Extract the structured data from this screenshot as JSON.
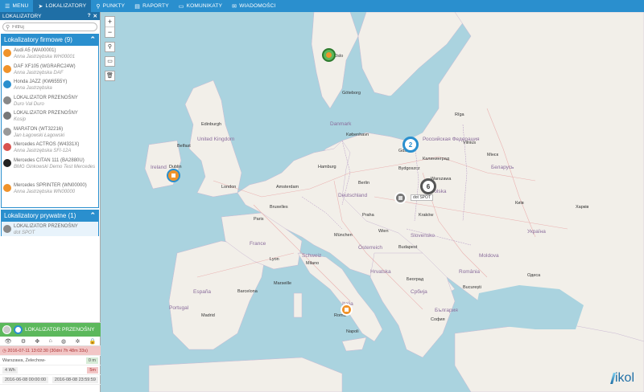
{
  "topbar": {
    "tabs": [
      {
        "label": "MENU",
        "icon": "menu-icon"
      },
      {
        "label": "LOKALIZATORY",
        "icon": "location-arrow-icon"
      },
      {
        "label": "PUNKTY",
        "icon": "pin-icon"
      },
      {
        "label": "RAPORTY",
        "icon": "file-icon"
      },
      {
        "label": "KOMUNIKATY",
        "icon": "monitor-icon"
      },
      {
        "label": "WIADOMOŚCI",
        "icon": "chat-icon"
      }
    ]
  },
  "sidebar": {
    "title": "LOKALIZATORY",
    "search_placeholder": "Filtruj",
    "group1": {
      "label": "Lokalizatory firmowe (9)",
      "items": [
        {
          "name": "Audi A5 (WA00001)",
          "sub": "Anna Jastrzębska WH00001",
          "color": "#f0932b"
        },
        {
          "name": "DAF XF105 (WGRARC24W)",
          "sub": "Anna Jastrzębska DAF",
          "color": "#f0932b"
        },
        {
          "name": "Honda JAZZ (KW6555Y)",
          "sub": "Anna Jastrzębska",
          "color": "#2a8fce"
        },
        {
          "name": "LOKALIZATOR PRZENOŚNY",
          "sub": "Duro Val Duro",
          "color": "#888888"
        },
        {
          "name": "LOKALIZATOR PRZENOŚNY",
          "sub": "Kosip",
          "color": "#777777"
        },
        {
          "name": "MARATON (WT32216)",
          "sub": "Jan Łagowski Łagowski",
          "color": "#999999"
        },
        {
          "name": "Mercedes ACTROS (W4331X)",
          "sub": "Anna Jastrzębska SFI-12A",
          "color": "#d9534f"
        },
        {
          "name": "Mercedes CITAN 111 (BA2880U)",
          "sub": "BMG Ginkowski Demo Test Mercedes",
          "color": "#222222"
        },
        {
          "name": "Mercedes SPRINTER (WN00000)",
          "sub": "Anna Jastrzębska WN00000",
          "color": "#f0932b"
        }
      ]
    },
    "group2": {
      "label": "Lokalizatory prywatne (1)",
      "items": [
        {
          "name": "LOKALIZATOR PRZENOŚNY",
          "sub": "dot SPOT",
          "color": "#888888"
        }
      ]
    }
  },
  "panel": {
    "title": "LOKALIZATOR PRZENOŚNY",
    "row1": "2016-07-11 13:02:30 (30dni 7h 48m 33s)",
    "row2_left": "Warszawa, Żelechow-",
    "row2_right": "0 m",
    "row3_left": "4 Wh",
    "row3_right": "5m",
    "row4_left": "2016-06-08 00:00:00",
    "row4_right": "2016-08-08 23:59:59"
  },
  "map": {
    "zoom_in": "+",
    "zoom_out": "−",
    "clusters": [
      {
        "count": "2",
        "color": "#2a8fce"
      },
      {
        "count": "6",
        "color": "#555555"
      }
    ],
    "spot_label": "dot SPOT",
    "logo": "ikol",
    "labels": {
      "russia": "Российская Федерация",
      "belarus": "Беларусь",
      "ukraine": "Україна",
      "danmark": "Danmark",
      "deutschland": "Deutschland",
      "france": "France",
      "uk": "United Kingdom",
      "ireland": "Ireland",
      "polska": "Polska",
      "italia": "Italia",
      "espana": "España",
      "portugal": "Portugal",
      "slovensko": "Slovensko",
      "romania": "România",
      "moldova": "Moldova",
      "schweiz": "Schweiz",
      "osterreich": "Österreich",
      "srbija": "Србија",
      "blgaria": "България",
      "hrvatska": "Hrvatska",
      "berlin": "Berlin",
      "london": "London",
      "paris": "Paris",
      "warszawa": "Warszawa",
      "madrid": "Madrid",
      "roma": "Roma",
      "wien": "Wien",
      "praha": "Praha",
      "budapest": "Budapest",
      "kyiv": "Київ",
      "minsk": "Мінск",
      "vilnius": "Vilnius",
      "riga": "Rīga",
      "kaliningrad": "Калининград",
      "hamburg": "Hamburg",
      "amsterdam": "Amsterdam",
      "bruxelles": "Bruxelles",
      "kobenhavn": "København",
      "dublin": "Dublin",
      "edinburgh": "Edinburgh",
      "belfast": "Belfast",
      "oslo": "Oslo",
      "goteborg": "Göteborg",
      "bucuresti": "București",
      "beograd": "Београд",
      "sofija": "София",
      "odesa": "Одеса",
      "kharkiv": "Харків",
      "lyon": "Lyon",
      "marseille": "Marseille",
      "barcelona": "Barcelona",
      "milano": "Milano",
      "napoli": "Napoli",
      "munchen": "München",
      "krakow": "Kraków",
      "gdansk": "Gdańsk",
      "bydgoszcz": "Bydgoszcz"
    }
  }
}
